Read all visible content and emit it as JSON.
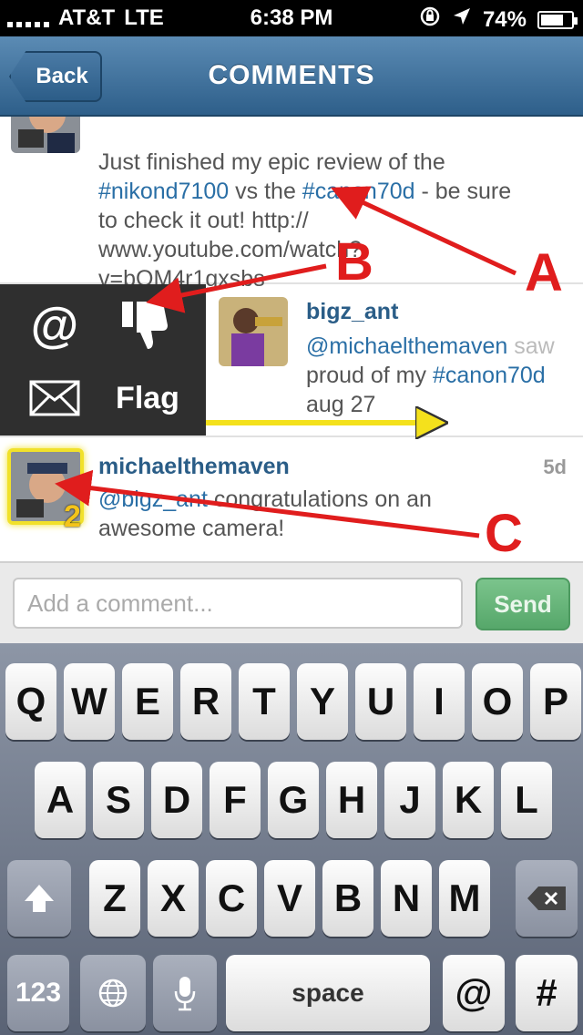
{
  "status_bar": {
    "carrier": "AT&T",
    "network": "LTE",
    "time": "6:38 PM",
    "battery_percent": "74%",
    "battery_level": 0.74
  },
  "nav": {
    "back_label": "Back",
    "title": "COMMENTS"
  },
  "comments": [
    {
      "text_parts": [
        "Just finished my epic review of the ",
        "#nikond7100",
        " vs the ",
        "#canon70d",
        " - be sure to check it out! http://\nwww.youtube.com/watch?\nv=bOM4r1gxsbs"
      ]
    },
    {
      "username": "bigz_ant",
      "mention": "@michaelthemaven",
      "text_after_mention": " saw",
      "line2_prefix": "proud of my ",
      "hashtag": "#canon70d",
      "date": "aug 27"
    },
    {
      "username": "michaelthemaven",
      "time_ago": "5d",
      "mention": "@bigz_ant",
      "text": " congratulations on an awesome camera!",
      "badge": "2"
    }
  ],
  "actions": {
    "mention_symbol": "@",
    "flag_label": "Flag",
    "icons": [
      "at-icon",
      "dislike-icon",
      "mail-icon"
    ]
  },
  "input": {
    "placeholder": "Add a comment...",
    "send_label": "Send"
  },
  "keyboard": {
    "row1": [
      "Q",
      "W",
      "E",
      "R",
      "T",
      "Y",
      "U",
      "I",
      "O",
      "P"
    ],
    "row2": [
      "A",
      "S",
      "D",
      "F",
      "G",
      "H",
      "J",
      "K",
      "L"
    ],
    "row3": [
      "Z",
      "X",
      "C",
      "V",
      "B",
      "N",
      "M"
    ],
    "numbers_key": "123",
    "space_key": "space",
    "at_key": "@",
    "hash_key": "#"
  },
  "annotations": {
    "a": "A",
    "b": "B",
    "c": "C",
    "arrow_red": "#e01d1d",
    "arrow_yellow": "#f4e11c"
  },
  "colors": {
    "link": "#2a6fa6",
    "username": "#2a5d87",
    "nav": "#3d6f9a",
    "send": "#5fae73"
  }
}
